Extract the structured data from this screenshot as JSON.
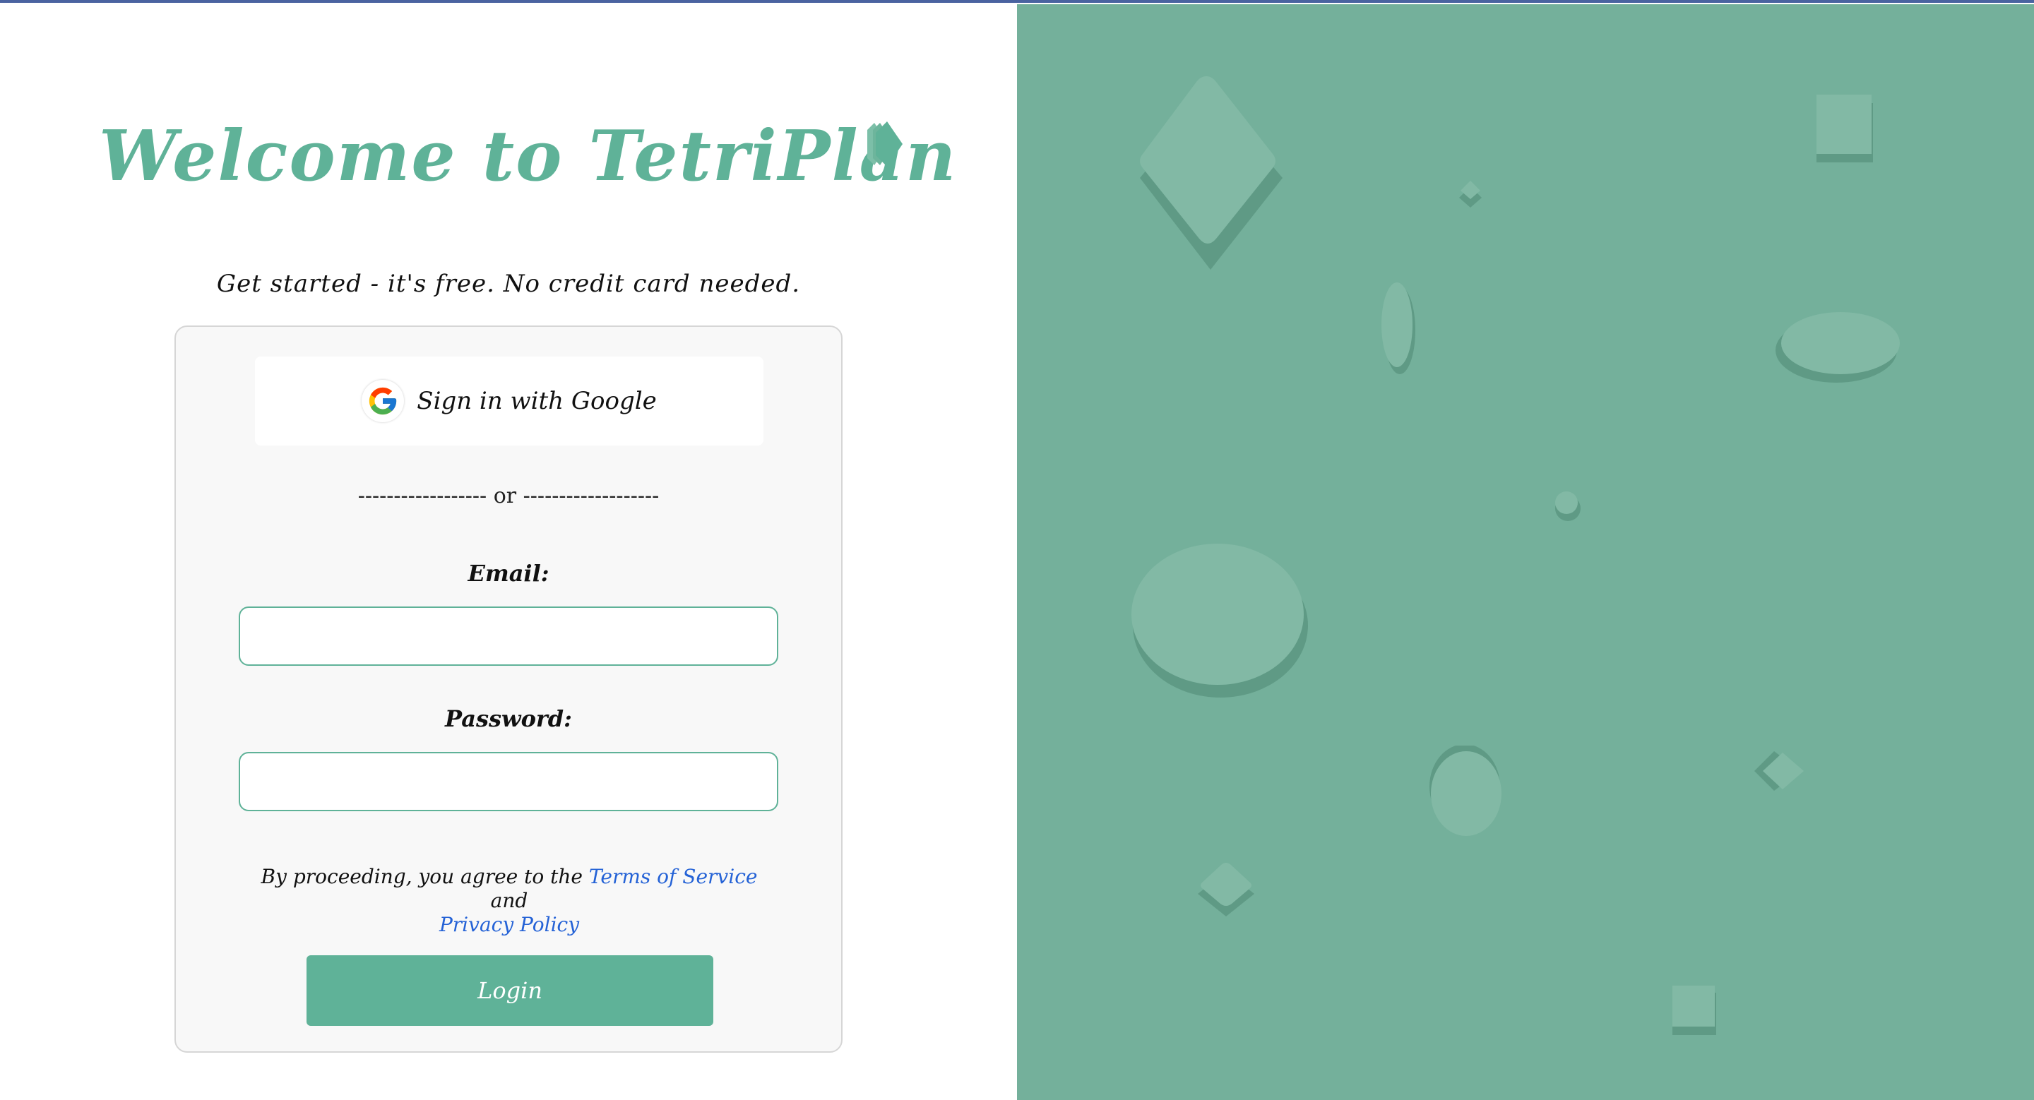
{
  "header": {
    "title": "Welcome to TetriPlan",
    "subtitle": "Get started - it's free. No credit card needed."
  },
  "login_card": {
    "google_button_label": "Sign in with Google",
    "divider_text": "------------------ or -------------------",
    "email_label": "Email:",
    "email_value": "",
    "password_label": "Password:",
    "password_value": "",
    "terms_prefix": "By proceeding, you agree to the",
    "terms_link": "Terms of Service",
    "terms_and": "and",
    "privacy_link": "Privacy Policy",
    "login_button_label": "Login"
  },
  "icons": {
    "logo": "stacked-diamond-icon",
    "google": "google-g-icon"
  },
  "colors": {
    "brand_green": "#5fb298",
    "panel_green": "#74b09b",
    "link_blue": "#2462d6"
  }
}
